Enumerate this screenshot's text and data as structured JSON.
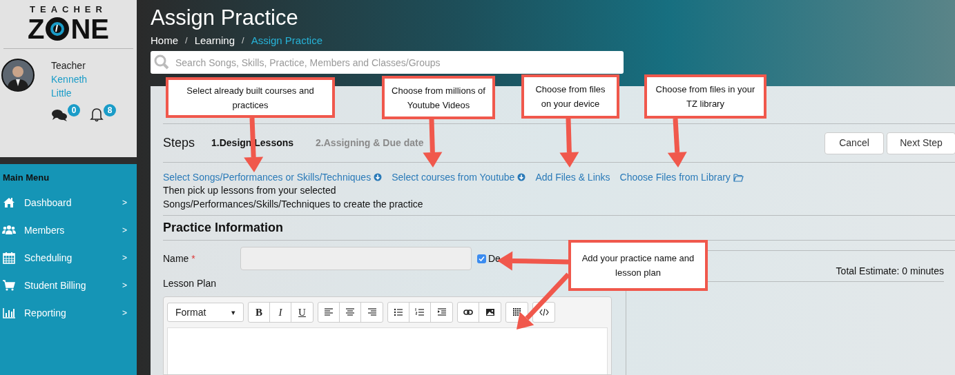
{
  "logo": {
    "top": "TEACHER",
    "left": "Z",
    "right": "NE"
  },
  "user": {
    "role": "Teacher",
    "first_name": "Kenneth",
    "last_name": "Little",
    "messages": "0",
    "notifications": "8"
  },
  "sidebar": {
    "title": "Main Menu",
    "items": [
      {
        "label": "Dashboard",
        "chevron": ">"
      },
      {
        "label": "Members",
        "chevron": ">"
      },
      {
        "label": "Scheduling",
        "chevron": ">"
      },
      {
        "label": "Student Billing",
        "chevron": ">"
      },
      {
        "label": "Reporting",
        "chevron": ">"
      }
    ]
  },
  "header": {
    "title": "Assign Practice",
    "breadcrumb": [
      {
        "label": "Home",
        "selected": false
      },
      {
        "label": "Learning",
        "selected": false
      },
      {
        "label": "Assign Practice",
        "selected": true
      }
    ],
    "separator": "/",
    "search": {
      "placeholder": "Search Songs, Skills, Practice, Members and Classes/Groups"
    }
  },
  "steps": {
    "title": "Steps",
    "items": [
      {
        "label": "1.Design Lessons",
        "selected": true
      },
      {
        "label": "2.Assigning & Due date",
        "selected": false
      }
    ],
    "buttons": [
      "Cancel",
      "Next Step"
    ]
  },
  "links": [
    {
      "label": "Select Songs/Performances or Skills/Techniques",
      "kind": "dropdown"
    },
    {
      "label": "Select courses from Youtube",
      "kind": "dropdown"
    },
    {
      "label": "Add Files & Links",
      "kind": "plain"
    },
    {
      "label": "Choose Files from Library",
      "kind": "library"
    }
  ],
  "hint_lines": [
    "Then pick up lessons from your selected",
    "Songs/Performances/Skills/Techniques to create the practice"
  ],
  "practice_info": {
    "title": "Practice Information",
    "name_label": "Name",
    "required_mark": "*",
    "default_name": {
      "label": "De",
      "checked": true
    },
    "lesson_plan_label": "Lesson Plan",
    "format_select": "Format",
    "format_caret": "▾",
    "text_buttons": [
      "B",
      "I",
      "U"
    ]
  },
  "estimate": "Total Estimate: 0 minutes",
  "callouts": [
    {
      "text": "Select already built courses and practices"
    },
    {
      "text": "Choose from millions of Youtube Videos"
    },
    {
      "text": "Choose from files on your device"
    },
    {
      "text": "Choose from files in your TZ library"
    },
    {
      "text": "Add your practice name and lesson plan"
    }
  ]
}
